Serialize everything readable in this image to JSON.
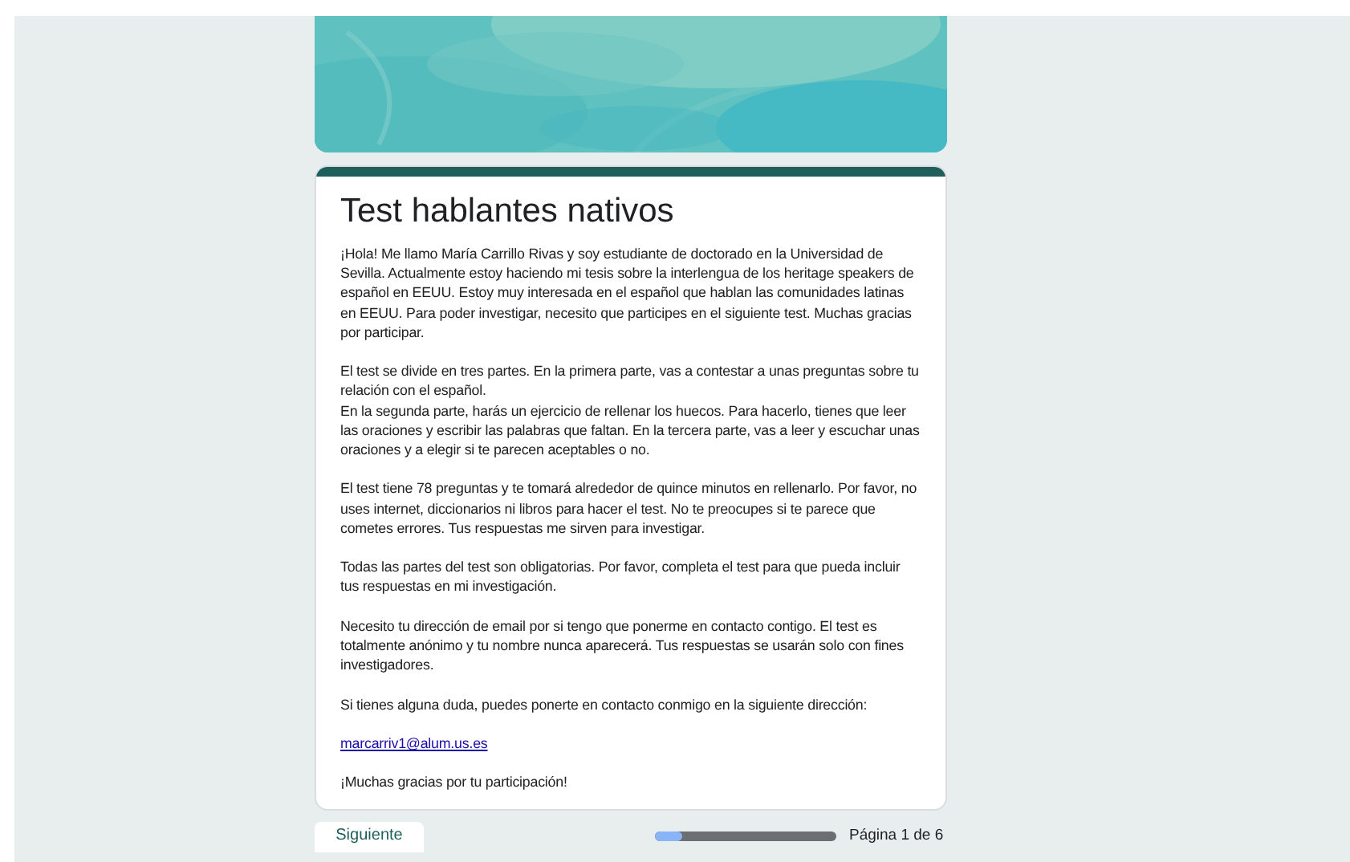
{
  "form": {
    "title": "Test hablantes nativos",
    "paragraphs": [
      "¡Hola! Me llamo María Carrillo Rivas y soy estudiante de doctorado en la Universidad de Sevilla. Actualmente estoy haciendo mi tesis sobre la interlengua de los heritage speakers de español en EEUU. Estoy muy interesada en el español que hablan las comunidades latinas en EEUU. Para poder investigar, necesito que participes en el siguiente test. Muchas gracias por participar.",
      "El test se divide en tres partes. En la primera parte, vas a contestar a unas preguntas sobre tu relación con el español.\nEn la segunda parte, harás un ejercicio de rellenar los huecos. Para hacerlo, tienes que leer las oraciones y escribir las palabras que faltan. En la tercera parte, vas a leer y escuchar unas oraciones y a elegir si te parecen aceptables o no.",
      "El test tiene 78 preguntas y te tomará alrededor de quince minutos en rellenarlo. Por favor, no uses internet, diccionarios ni libros para hacer el test. No te preocupes si te parece que cometes errores. Tus respuestas me sirven para investigar.",
      "Todas las partes del test son obligatorias. Por favor, completa el test para que pueda incluir tus respuestas en mi investigación.",
      "Necesito tu dirección de email por si tengo que ponerme en contacto contigo. El test es totalmente anónimo y tu nombre nunca aparecerá. Tus respuestas se usarán solo con fines investigadores.",
      "Si tienes alguna duda, puedes ponerte en contacto conmigo en la siguiente dirección:"
    ],
    "email": "marcarriv1@alum.us.es",
    "closing": "¡Muchas gracias por tu participación!"
  },
  "footer": {
    "next_button": "Siguiente",
    "progress": {
      "level": 0.15
    },
    "page_label": "Página 1 de 6"
  }
}
